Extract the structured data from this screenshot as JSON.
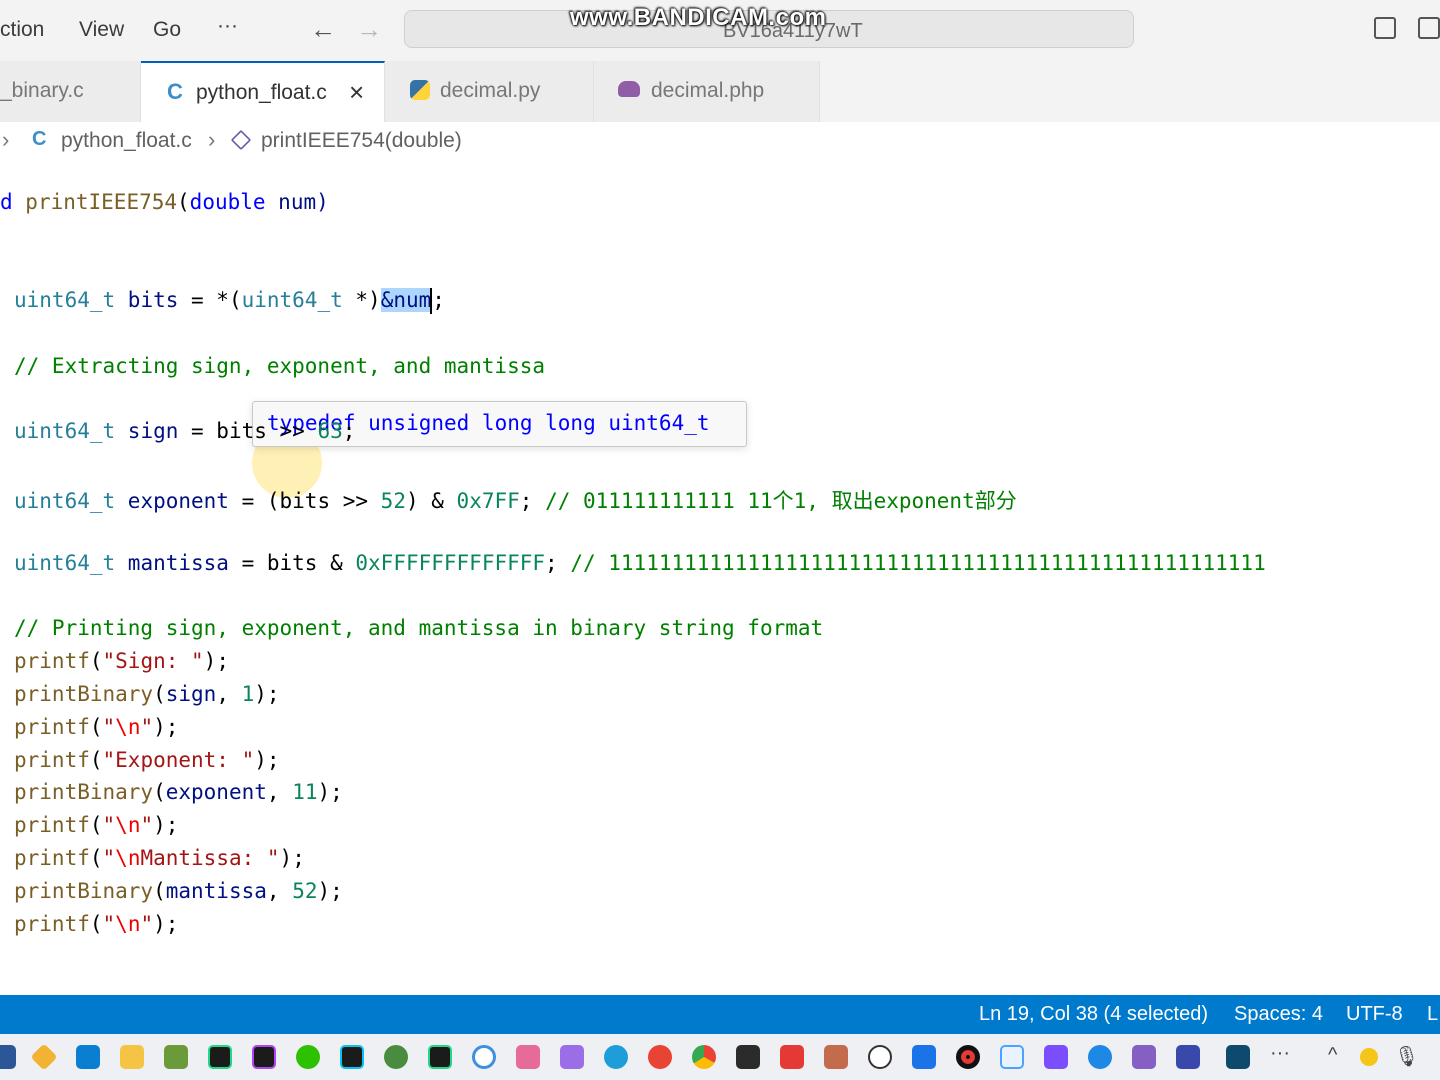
{
  "menu": {
    "items": [
      "ction",
      "View",
      "Go",
      "···"
    ]
  },
  "title_bar": {
    "command_center_text": "BV16a411y7wT",
    "watermark": "www.BANDICAM.com"
  },
  "tabs": [
    {
      "label": "_binary.c",
      "icon": "c-file-icon",
      "active": false
    },
    {
      "label": "python_float.c",
      "icon": "c-file-icon",
      "active": true
    },
    {
      "label": "decimal.py",
      "icon": "python-file-icon",
      "active": false
    },
    {
      "label": "decimal.php",
      "icon": "php-file-icon",
      "active": false
    }
  ],
  "breadcrumb": {
    "file": "python_float.c",
    "symbol": "printIEEE754(double)",
    "file_icon_letter": "C"
  },
  "hover": {
    "text": "typedef unsigned long long uint64_t"
  },
  "code": {
    "l1_a": "d ",
    "l1_fn": "printIEEE754",
    "l1_b": "(",
    "l1_ty": "double",
    "l1_var": " num)",
    "l2_ty": "uint64_t",
    "l2_var": " bits ",
    "l2_op": "= *(",
    "l2_ty2": "uint64_t",
    "l2_op2": " *)",
    "l2_sel": "&num",
    "l2_end": ";",
    "l3_cm": "// Extracting sign, exponent, and mantissa",
    "l4_ty": "uint64_t",
    "l4_var": " sign ",
    "l4_op": "= bits >> ",
    "l4_num": "63",
    "l4_end": ";",
    "l5_ty": "uint64_t",
    "l5_var": " exponent ",
    "l5_op": "= (bits >> ",
    "l5_num": "52",
    "l5_op2": ") & ",
    "l5_hex": "0x7FF",
    "l5_end": "; ",
    "l5_cm": "// 011111111111 11个1, 取出exponent部分",
    "l6_ty": "uint64_t",
    "l6_var": " mantissa ",
    "l6_op": "= bits & ",
    "l6_hex": "0xFFFFFFFFFFFFF",
    "l6_end": "; ",
    "l6_cm": "// 1111111111111111111111111111111111111111111111111111",
    "l7_cm": "// Printing sign, exponent, and mantissa in binary string format",
    "p1_fn": "printf",
    "p1_str": "\"Sign: \"",
    "p2_fn": "printBinary",
    "p2_var": "sign",
    "p2_num": "1",
    "p3_fn": "printf",
    "p3_q1": "\"",
    "p3_esc": "\\n",
    "p3_q2": "\"",
    "p4_fn": "printf",
    "p4_str": "\"Exponent: \"",
    "p5_fn": "printBinary",
    "p5_var": "exponent",
    "p5_num": "11",
    "p6_fn": "printf",
    "p6_q1": "\"",
    "p6_esc": "\\n",
    "p6_q2": "\"",
    "p7_fn": "printf",
    "p7_q1": "\"",
    "p7_esc": "\\n",
    "p7_str": "Mantissa: \"",
    "p8_fn": "printBinary",
    "p8_var": "mantissa",
    "p8_num": "52",
    "p9_fn": "printf",
    "p9_q1": "\"",
    "p9_esc": "\\n",
    "p9_q2": "\""
  },
  "status": {
    "position": "Ln 19, Col 38 (4 selected)",
    "spaces": "Spaces: 4",
    "encoding": "UTF-8",
    "eol": "L"
  },
  "taskbar": {
    "icons": [
      "vscode-icon",
      "file-explorer-icon",
      "clion-icon",
      "phpstorm-icon",
      "wechat-icon",
      "goland-icon",
      "pycharm-icon",
      "edge-icon",
      "chrome-icon",
      "terminal-icon",
      "youdao-icon",
      "visual-studio-icon"
    ],
    "overflow": "···"
  },
  "colors": {
    "accent": "#007acc",
    "active_tab_border": "#005fb8",
    "selection": "#add6ff",
    "comment": "#008000",
    "string": "#a31515",
    "number": "#098658",
    "type": "#267f99",
    "function": "#795e26"
  }
}
